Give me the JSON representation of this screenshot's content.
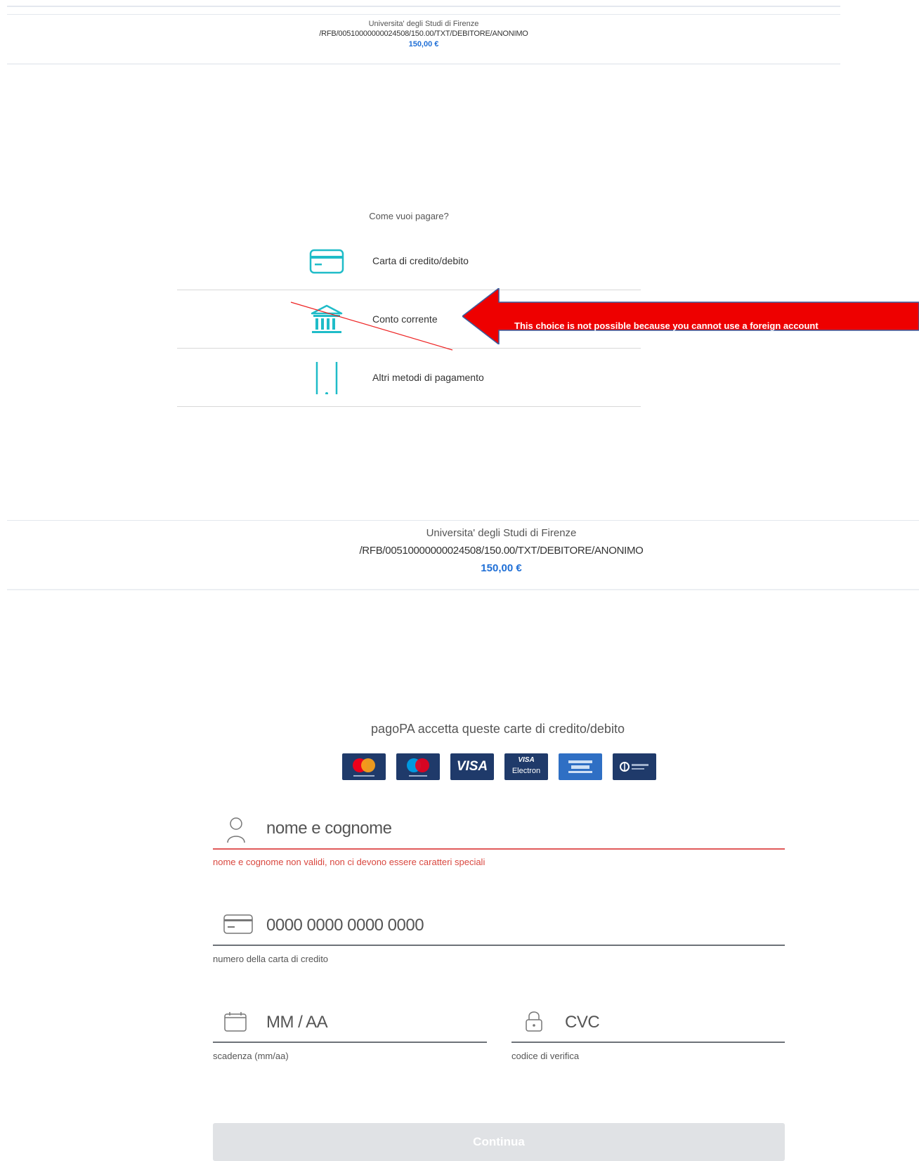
{
  "top": {
    "organization": "Universita' degli Studi di Firenze",
    "reference": "/RFB/00510000000024508/150.00/TXT/DEBITORE/ANONIMO",
    "amount": "150,00 €"
  },
  "payment_choice": {
    "question": "Come vuoi pagare?",
    "options": [
      {
        "label": "Carta di credito/debito",
        "icon": "credit-card-icon"
      },
      {
        "label": "Conto corrente",
        "icon": "bank-icon"
      },
      {
        "label": "Altri metodi di pagamento",
        "icon": "smartphone-icon"
      }
    ]
  },
  "annotation": {
    "text": "This choice is not possible because you cannot use a  foreign account",
    "arrow_color": "#ee0000",
    "strike_color": "#ee2222"
  },
  "bottom": {
    "organization": "Universita' degli Studi di Firenze",
    "reference": "/RFB/00510000000024508/150.00/TXT/DEBITORE/ANONIMO",
    "amount": "150,00 €"
  },
  "card_form": {
    "accepts_title": "pagoPA accetta queste carte di credito/debito",
    "brands": [
      {
        "name": "Mastercard",
        "label": ""
      },
      {
        "name": "Maestro",
        "label": ""
      },
      {
        "name": "Visa",
        "label": "VISA"
      },
      {
        "name": "Visa Electron",
        "label": "VISA"
      },
      {
        "name": "American Express",
        "label": ""
      },
      {
        "name": "Diners Club",
        "label": ""
      }
    ],
    "visa_electron_sub": "Electron",
    "name_field": {
      "placeholder": "nome e cognome",
      "error": "nome e cognome non validi, non ci devono essere caratteri speciali"
    },
    "card_field": {
      "placeholder": "0000 0000 0000 0000",
      "help": "numero della carta di credito"
    },
    "expiry_field": {
      "placeholder": "MM / AA",
      "help": "scadenza (mm/aa)"
    },
    "cvc_field": {
      "placeholder": "CVC",
      "help": "codice di verifica"
    },
    "continue_label": "Continua"
  },
  "colors": {
    "accent": "#1f6fd6",
    "icon_teal": "#1fbcc8",
    "error": "#d9473f",
    "button_disabled": "#e0e2e5"
  }
}
